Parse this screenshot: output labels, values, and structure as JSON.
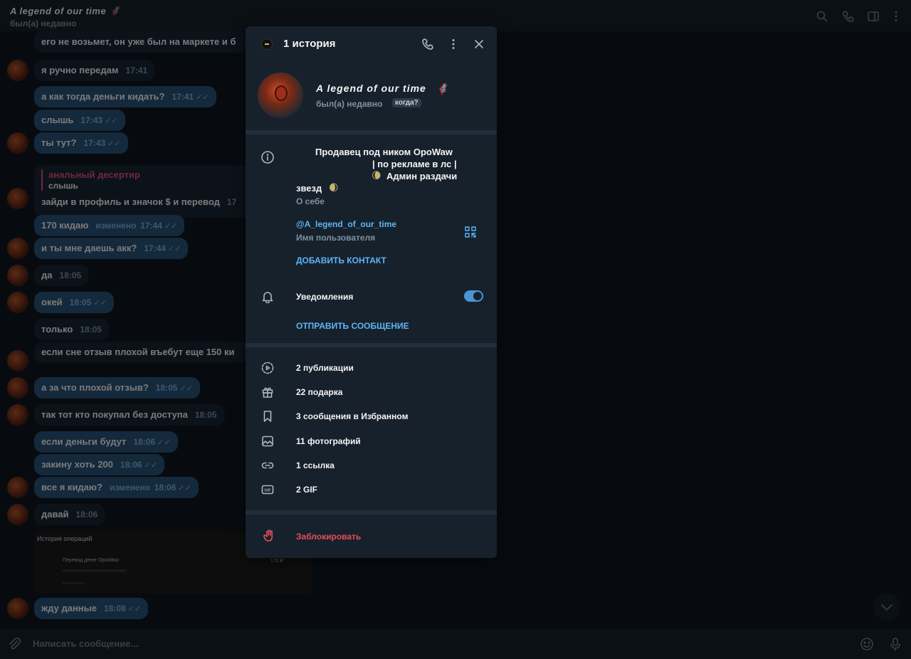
{
  "chat": {
    "title": "A legend of our time",
    "title_emoji": "🦸",
    "status": "был(а) недавно",
    "input_placeholder": "Написать сообщение...",
    "messages": [
      {
        "text": "его не возьмет, он уже был на маркете и б",
        "time": "",
        "dir": "in"
      },
      {
        "text": "я ручно передам",
        "time": "17:41",
        "dir": "in"
      },
      {
        "text": "а как тогда деньги кидать?",
        "time": "17:41",
        "dir": "out",
        "ticks": "✓✓"
      },
      {
        "text": "слышь",
        "time": "17:43",
        "dir": "out",
        "ticks": "✓✓"
      },
      {
        "text": "ты тут?",
        "time": "17:43",
        "dir": "out",
        "ticks": "✓✓"
      },
      {
        "text": "зайди в профиль и значок $ и перевод",
        "time": "17",
        "dir": "in"
      },
      {
        "text": "170 кидаю",
        "time": "17:44",
        "edited": "изменено",
        "dir": "out",
        "ticks": "✓✓"
      },
      {
        "text": "и ты мне даешь акк?",
        "time": "17:44",
        "dir": "out",
        "ticks": "✓✓"
      },
      {
        "text": "да",
        "time": "18:05",
        "dir": "in"
      },
      {
        "text": "окей",
        "time": "18:05",
        "dir": "out",
        "ticks": "✓✓"
      },
      {
        "text": "только",
        "time": "18:05",
        "dir": "in"
      },
      {
        "text": "если сне отзыв плохой въебут еще 150 ки",
        "time": "",
        "dir": "in"
      },
      {
        "text": "а за что плохой отзыв?",
        "time": "18:05",
        "dir": "out",
        "ticks": "✓✓"
      },
      {
        "text": "так тот кто покупал без доступа",
        "time": "18:05",
        "dir": "in"
      },
      {
        "text": "если деньги будут",
        "time": "18:06",
        "dir": "out",
        "ticks": "✓✓"
      },
      {
        "text": "закину хоть 200",
        "time": "18:06",
        "dir": "out",
        "ticks": "✓✓"
      },
      {
        "text": "все я кидаю?",
        "time": "18:06",
        "edited": "изменено",
        "dir": "out",
        "ticks": "✓✓"
      },
      {
        "text": "давай",
        "time": "18:06",
        "dir": "in"
      },
      {
        "text": "жду данные",
        "time": "18:08",
        "dir": "out",
        "ticks": "✓✓"
      }
    ],
    "reply": {
      "name": "анальный десертир",
      "quoted": "слышь"
    },
    "screenshot": {
      "title": "История операций",
      "row": "Перевод денег OpoWaw",
      "amount": "170 ₽"
    }
  },
  "profile": {
    "header_title": "1 история",
    "name": "A legend of our time",
    "name_emoji": "🦸",
    "status": "был(а) недавно",
    "when_badge": "когда?",
    "bio_line1": "Продавец под ником OpoWaw",
    "bio_line2": "| по рекламе в лс |",
    "bio_line3_emoji": "🌘",
    "bio_line3": "Админ раздачи",
    "bio_line4": "звезд",
    "bio_line4_emoji": "🌒",
    "bio_caption": "О себе",
    "username": "@A_legend_of_our_time",
    "username_caption": "Имя пользователя",
    "add_contact": "ДОБАВИТЬ КОНТАКТ",
    "notifications_label": "Уведомления",
    "notifications_on": true,
    "send_message": "ОТПРАВИТЬ СООБЩЕНИЕ",
    "media": [
      {
        "icon": "stories-icon",
        "label": "2 публикации"
      },
      {
        "icon": "gift-icon",
        "label": "22 подарка"
      },
      {
        "icon": "bookmark-icon",
        "label": "3 сообщения в Избранном"
      },
      {
        "icon": "photo-icon",
        "label": "11 фотографий"
      },
      {
        "icon": "link-icon",
        "label": "1 ссылка"
      },
      {
        "icon": "gif-icon",
        "label": "2 GIF"
      }
    ],
    "block": "Заблокировать"
  },
  "colors": {
    "background": "#0e1621",
    "panel": "#17212b",
    "accent": "#5eb5f7",
    "danger": "#e0505a",
    "outgoing_bubble": "#2b5278"
  }
}
